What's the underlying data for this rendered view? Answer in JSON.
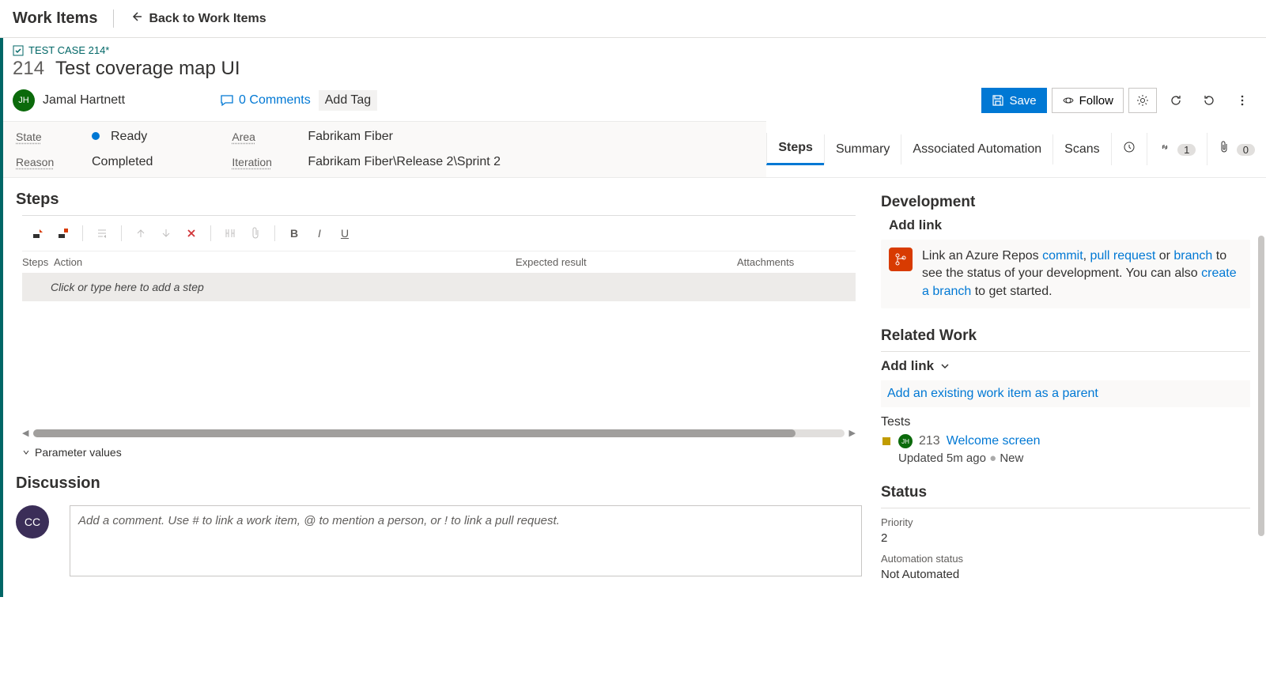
{
  "topbar": {
    "title": "Work Items",
    "back": "Back to Work Items"
  },
  "breadcrumb": "TEST CASE 214*",
  "workitem": {
    "id": "214",
    "title": "Test coverage map UI",
    "assignee": "Jamal Hartnett",
    "assignee_initials": "JH",
    "comments": "0 Comments",
    "add_tag": "Add Tag"
  },
  "toolbar": {
    "save": "Save",
    "follow": "Follow"
  },
  "fields": {
    "state_lbl": "State",
    "state_val": "Ready",
    "reason_lbl": "Reason",
    "reason_val": "Completed",
    "area_lbl": "Area",
    "area_val": "Fabrikam Fiber",
    "iter_lbl": "Iteration",
    "iter_val": "Fabrikam Fiber\\Release 2\\Sprint 2"
  },
  "tabs": {
    "steps": "Steps",
    "summary": "Summary",
    "auto": "Associated Automation",
    "scans": "Scans",
    "links_count": "1",
    "attach_count": "0"
  },
  "steps": {
    "heading": "Steps",
    "col_steps": "Steps",
    "col_action": "Action",
    "col_expected": "Expected result",
    "col_attach": "Attachments",
    "placeholder": "Click or type here to add a step",
    "param": "Parameter values"
  },
  "discussion": {
    "heading": "Discussion",
    "placeholder": "Add a comment. Use # to link a work item, @ to mention a person, or ! to link a pull request.",
    "cc": "CC"
  },
  "side": {
    "dev_h": "Development",
    "addlink": "Add link",
    "dev_text1": "Link an Azure Repos ",
    "dev_commit": "commit",
    "dev_sep": ", ",
    "dev_pr": "pull request",
    "dev_text2": " or ",
    "dev_branch": "branch",
    "dev_text3": " to see the status of your development. You can also ",
    "dev_create": "create a branch",
    "dev_text4": " to get started.",
    "related_h": "Related Work",
    "add_parent": "Add an existing work item as a parent",
    "tests_lbl": "Tests",
    "test_id": "213",
    "test_name": "Welcome screen",
    "test_sub": "Updated 5m ago",
    "test_state": "New",
    "status_h": "Status",
    "priority_lbl": "Priority",
    "priority_val": "2",
    "auto_lbl": "Automation status",
    "auto_val": "Not Automated"
  }
}
